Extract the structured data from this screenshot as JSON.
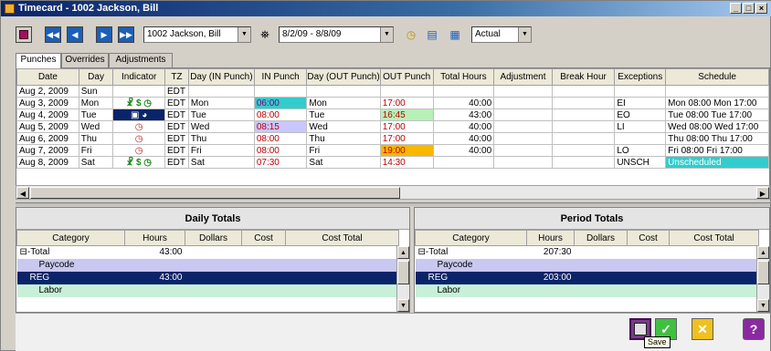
{
  "window": {
    "title": "Timecard - 1002 Jackson, Bill",
    "minimize": "_",
    "maximize": "□",
    "close": "×"
  },
  "toolbar": {
    "employee": "1002 Jackson, Bill",
    "date_range": "8/2/09 - 8/8/09",
    "mode": "Actual",
    "nav_first": "◀◀",
    "nav_prev": "◀",
    "nav_next": "▶",
    "nav_last": "▶▶"
  },
  "tabs": [
    "Punches",
    "Overrides",
    "Adjustments"
  ],
  "grid": {
    "columns": [
      "Date",
      "Day",
      "Indicator",
      "TZ",
      "Day (IN Punch)",
      "IN Punch",
      "Day (OUT Punch)",
      "OUT Punch",
      "Total Hours",
      "Adjustment",
      "Break Hour",
      "Exceptions",
      "Schedule"
    ],
    "rows": [
      {
        "date": "Aug 2, 2009",
        "day": "Sun",
        "indicator": "",
        "tz": "EDT",
        "day_in": "",
        "in": "",
        "day_out": "",
        "out": "",
        "total": "",
        "adj": "",
        "brk": "",
        "exc": "",
        "sched": ""
      },
      {
        "date": "Aug 3, 2009",
        "day": "Mon",
        "indicator": "☧ $ ◷",
        "tz": "EDT",
        "day_in": "Mon",
        "in": "06:00",
        "day_out": "Mon",
        "out": "17:00",
        "total": "40:00",
        "adj": "",
        "brk": "",
        "exc": "EI",
        "sched": "Mon 08:00 Mon 17:00"
      },
      {
        "date": "Aug 4, 2009",
        "day": "Tue",
        "indicator": "▣ ◕",
        "tz": "EDT",
        "day_in": "Tue",
        "in": "08:00",
        "day_out": "Tue",
        "out": "16:45",
        "total": "43:00",
        "adj": "",
        "brk": "",
        "exc": "EO",
        "sched": "Tue 08:00 Tue 17:00"
      },
      {
        "date": "Aug 5, 2009",
        "day": "Wed",
        "indicator": "◷",
        "tz": "EDT",
        "day_in": "Wed",
        "in": "08:15",
        "day_out": "Wed",
        "out": "17:00",
        "total": "40:00",
        "adj": "",
        "brk": "",
        "exc": "LI",
        "sched": "Wed 08:00 Wed 17:00"
      },
      {
        "date": "Aug 6, 2009",
        "day": "Thu",
        "indicator": "◷",
        "tz": "EDT",
        "day_in": "Thu",
        "in": "08:00",
        "day_out": "Thu",
        "out": "17:00",
        "total": "40:00",
        "adj": "",
        "brk": "",
        "exc": "",
        "sched": "Thu 08:00 Thu 17:00"
      },
      {
        "date": "Aug 7, 2009",
        "day": "Fri",
        "indicator": "◷",
        "tz": "EDT",
        "day_in": "Fri",
        "in": "08:00",
        "day_out": "Fri",
        "out": "19:00",
        "total": "40:00",
        "adj": "",
        "brk": "",
        "exc": "LO",
        "sched": "Fri 08:00 Fri 17:00"
      },
      {
        "date": "Aug 8, 2009",
        "day": "Sat",
        "indicator": "☧ $ ◷",
        "tz": "EDT",
        "day_in": "Sat",
        "in": "07:30",
        "day_out": "Sat",
        "out": "14:30",
        "total": "",
        "adj": "",
        "brk": "",
        "exc": "UNSCH",
        "sched": "Unscheduled"
      }
    ]
  },
  "daily_totals": {
    "title": "Daily Totals",
    "columns": [
      "Category",
      "Hours",
      "Dollars",
      "Cost",
      "Cost Total"
    ],
    "rows": [
      {
        "category": "⊟-Total",
        "hours": "43:00"
      },
      {
        "category": "Paycode",
        "hours": ""
      },
      {
        "category": "REG",
        "hours": "43:00"
      },
      {
        "category": "Labor",
        "hours": ""
      }
    ]
  },
  "period_totals": {
    "title": "Period Totals",
    "columns": [
      "Category",
      "Hours",
      "Dollars",
      "Cost",
      "Cost Total"
    ],
    "rows": [
      {
        "category": "⊟-Total",
        "hours": "207:30"
      },
      {
        "category": "Paycode",
        "hours": ""
      },
      {
        "category": "REG",
        "hours": "203:00"
      },
      {
        "category": "Labor",
        "hours": ""
      }
    ]
  },
  "bottom": {
    "save_tooltip": "Save",
    "help": "?"
  },
  "colors": {
    "in_cyan": "#33cccc",
    "in_purple": "#c8c8ff",
    "out_green": "#b8f0b8",
    "out_orange": "#f8b800",
    "unscheduled": "#33cccc",
    "selected_row": "#0a246a",
    "paycode_row": "#c8c8f0",
    "labor_row": "#c8f0d8"
  }
}
